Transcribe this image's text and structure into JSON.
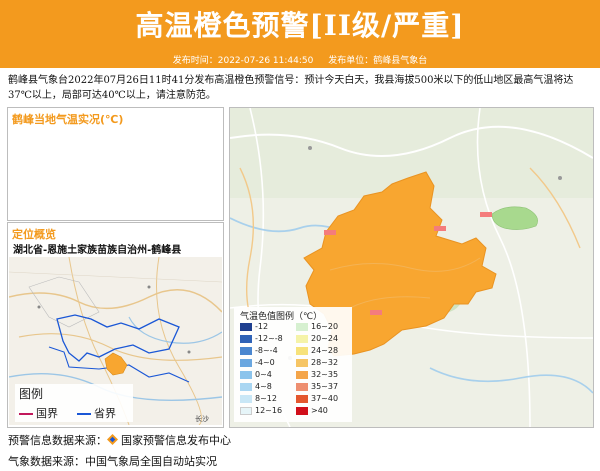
{
  "header": {
    "title": "高温橙色预警[II级/严重]",
    "publish_time": "发布时间：2022-07-26 11:44:50",
    "publisher": "发布单位：鹤峰县气象台"
  },
  "message": "鹤峰县气象台2022年07月26日11时41分发布高温橙色预警信号：预计今天白天，我县海拔500米以下的低山地区最高气温将达37℃以上，局部可达40℃以上，请注意防范。",
  "temp_panel": {
    "title": "鹤峰当地气温实况(℃)"
  },
  "location_panel": {
    "title": "定位概览",
    "name": "湖北省-恩施土家族苗族自治州-鹤峰县",
    "legend_title": "图例",
    "legend_items": [
      {
        "label": "国界",
        "color": "#c2185b"
      },
      {
        "label": "省界",
        "color": "#1a57d6"
      }
    ]
  },
  "map_labels": {
    "place1": "长沙"
  },
  "temp_legend": {
    "title": "气温色值图例（℃）",
    "items": [
      {
        "label": "-12",
        "color": "#1f3f8f"
      },
      {
        "label": "-12~-8",
        "color": "#2f62b6"
      },
      {
        "label": "-8~-4",
        "color": "#4a86cf"
      },
      {
        "label": "-4~0",
        "color": "#6aa7e0"
      },
      {
        "label": "0~4",
        "color": "#8cc4ec"
      },
      {
        "label": "4~8",
        "color": "#a9d6f2"
      },
      {
        "label": "8~12",
        "color": "#c9e7f6"
      },
      {
        "label": "12~16",
        "color": "#e6f5f8"
      },
      {
        "label": "16~20",
        "color": "#d6f0d0"
      },
      {
        "label": "20~24",
        "color": "#f5f3a8"
      },
      {
        "label": "24~28",
        "color": "#f7e27a"
      },
      {
        "label": "28~32",
        "color": "#f6c564"
      },
      {
        "label": "32~35",
        "color": "#f4a54a"
      },
      {
        "label": "35~37",
        "color": "#ee8f70"
      },
      {
        "label": "37~40",
        "color": "#e4572e"
      },
      {
        "label": ">40",
        "color": "#d10f1a"
      }
    ]
  },
  "footer": {
    "warning_source_label": "预警信息数据来源：",
    "warning_source": "国家预警信息发布中心",
    "weather_source": "气象数据来源：中国气象局全国自动站实况"
  },
  "colors": {
    "accent": "#f39a1e",
    "region_fill": "#f8a630"
  }
}
